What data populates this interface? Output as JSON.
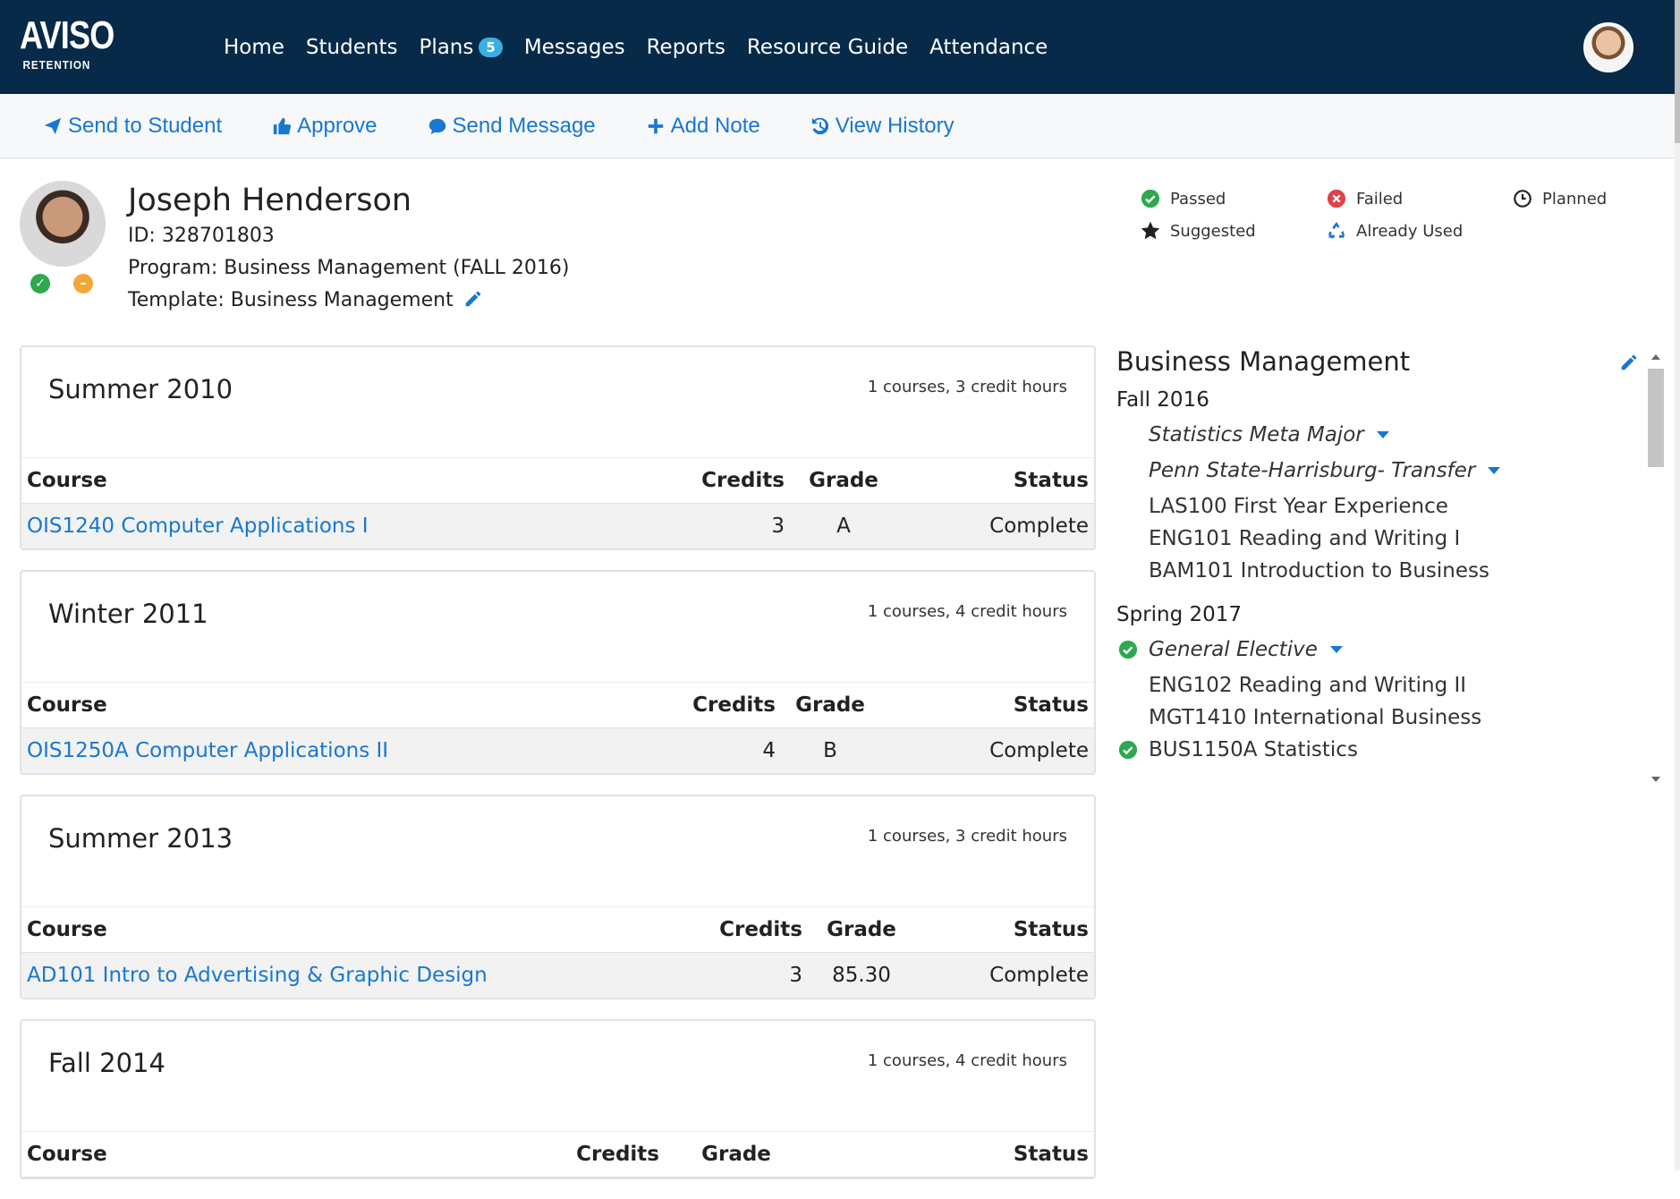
{
  "app": {
    "logo_main": "AVISO",
    "logo_sub": "RETENTION"
  },
  "nav": {
    "items": [
      {
        "label": "Home"
      },
      {
        "label": "Students"
      },
      {
        "label": "Plans",
        "badge": "5"
      },
      {
        "label": "Messages"
      },
      {
        "label": "Reports"
      },
      {
        "label": "Resource Guide"
      },
      {
        "label": "Attendance"
      }
    ]
  },
  "toolbar": {
    "send_to_student": "Send to Student",
    "approve": "Approve",
    "send_message": "Send Message",
    "add_note": "Add Note",
    "view_history": "View History"
  },
  "student": {
    "name": "Joseph Henderson",
    "id": "ID: 328701803",
    "program": "Program: Business Management (FALL 2016)",
    "template": "Template: Business Management"
  },
  "legend": {
    "passed": "Passed",
    "failed": "Failed",
    "planned": "Planned",
    "suggested": "Suggested",
    "already_used": "Already Used"
  },
  "terms": [
    {
      "title": "Summer 2010",
      "count": "1 courses, 3 credit hours",
      "headers": {
        "course": "Course",
        "credits": "Credits",
        "grade": "Grade",
        "status": "Status"
      },
      "rows": [
        {
          "course": "OIS1240 Computer Applications I",
          "credits": "3",
          "grade": "A",
          "status": "Complete"
        }
      ]
    },
    {
      "title": "Winter 2011",
      "count": "1 courses, 4 credit hours",
      "headers": {
        "course": "Course",
        "credits": "Credits",
        "grade": "Grade",
        "status": "Status"
      },
      "rows": [
        {
          "course": "OIS1250A Computer Applications II",
          "credits": "4",
          "grade": "B",
          "status": "Complete"
        }
      ]
    },
    {
      "title": "Summer 2013",
      "count": "1 courses, 3 credit hours",
      "headers": {
        "course": "Course",
        "credits": "Credits",
        "grade": "Grade",
        "status": "Status"
      },
      "rows": [
        {
          "course": "AD101 Intro to Advertising & Graphic Design",
          "credits": "3",
          "grade": "85.30",
          "status": "Complete"
        }
      ]
    },
    {
      "title": "Fall 2014",
      "count": "1 courses, 4 credit hours",
      "headers": {
        "course": "Course",
        "credits": "Credits",
        "grade": "Grade",
        "status": "Status"
      },
      "rows": []
    }
  ],
  "plan": {
    "title": "Business Management",
    "fall": {
      "label": "Fall 2016",
      "group1": "Statistics Meta Major",
      "group2": "Penn State-Harrisburg- Transfer",
      "courses": [
        "LAS100 First Year Experience",
        "ENG101 Reading and Writing I",
        "BAM101 Introduction to Business"
      ]
    },
    "spring": {
      "label": "Spring 2017",
      "group1": "General Elective",
      "courses": [
        "ENG102 Reading and Writing II",
        "MGT1410 International Business",
        "BUS1150A Statistics"
      ]
    }
  }
}
